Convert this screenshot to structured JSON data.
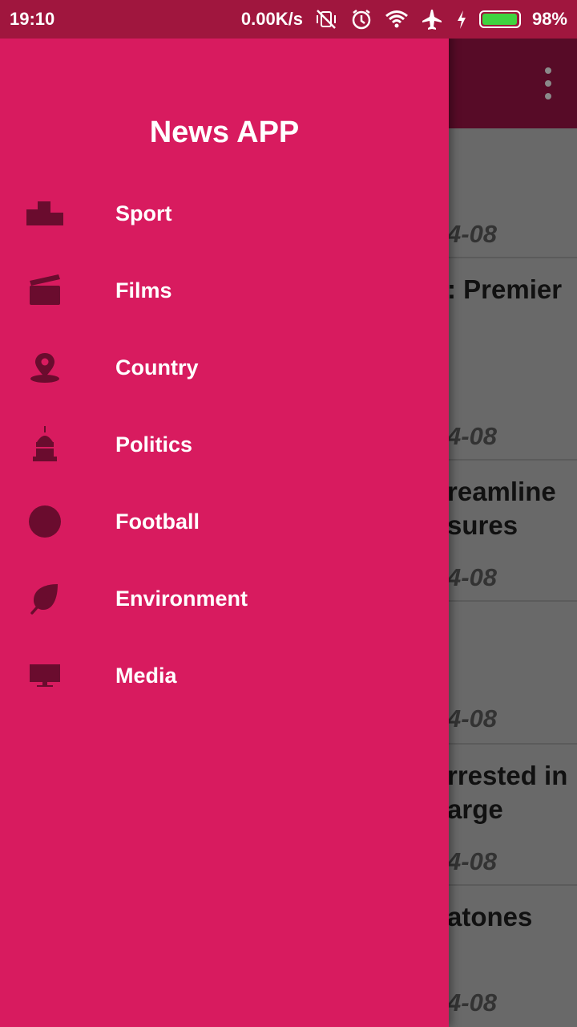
{
  "status_bar": {
    "time": "19:10",
    "network_speed": "0.00K/s",
    "battery_percent": "98%",
    "battery_level": 0.98,
    "icons": [
      "vibrate-off-icon",
      "alarm-icon",
      "wifi-icon",
      "airplane-icon",
      "charging-icon",
      "battery-icon"
    ]
  },
  "drawer": {
    "title": "News APP",
    "items": [
      {
        "label": "Sport",
        "icon": "podium-icon"
      },
      {
        "label": "Films",
        "icon": "clapperboard-icon"
      },
      {
        "label": "Country",
        "icon": "location-pin-icon"
      },
      {
        "label": "Politics",
        "icon": "capitol-icon"
      },
      {
        "label": "Football",
        "icon": "ball-icon"
      },
      {
        "label": "Environment",
        "icon": "leaf-icon"
      },
      {
        "label": "Media",
        "icon": "monitor-icon"
      }
    ]
  },
  "background_list": {
    "items": [
      {
        "title": "",
        "date": "4-08"
      },
      {
        "title": ": Premier",
        "date": "4-08"
      },
      {
        "title": "reamline\nsures",
        "date": "4-08"
      },
      {
        "title": "",
        "date": "4-08"
      },
      {
        "title": "rrested in\narge",
        "date": "4-08"
      },
      {
        "title": "atones",
        "date": "4-08"
      }
    ]
  },
  "colors": {
    "drawer_bg": "#d81b5f",
    "icon_color": "#6a0c2e",
    "status_bar": "#a0163e",
    "app_bar_dimmed": "#570b27",
    "scrim": "#696969"
  }
}
